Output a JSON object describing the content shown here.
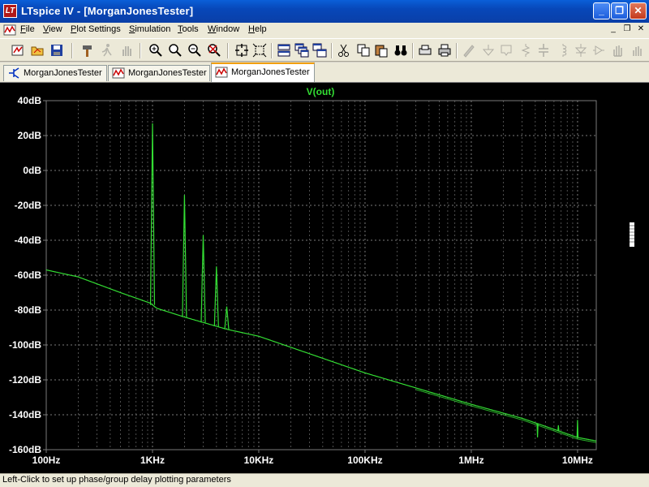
{
  "window": {
    "title": "LTspice IV - [MorganJonesTester]",
    "app_icon_glyph": "LT",
    "minimize_glyph": "_",
    "maximize_glyph": "❐",
    "close_glyph": "✕"
  },
  "menu": {
    "items": [
      "File",
      "View",
      "Plot Settings",
      "Simulation",
      "Tools",
      "Window",
      "Help"
    ],
    "doc_minimize_glyph": "_",
    "doc_restore_glyph": "❐",
    "doc_close_glyph": "✕"
  },
  "tabs": [
    {
      "label": "MorganJonesTester",
      "icon": "schematic-icon",
      "active": false
    },
    {
      "label": "MorganJonesTester",
      "icon": "waveform-icon",
      "active": false
    },
    {
      "label": "MorganJonesTester",
      "icon": "waveform-icon",
      "active": true
    }
  ],
  "colors": {
    "trace": "#33dd33",
    "grid": "#7a7a7a",
    "axis_text": "#ffffff",
    "trace_label": "#33dd33",
    "plot_bg": "#000000"
  },
  "chart_data": {
    "type": "line",
    "title": "V(out)",
    "x_scale": "log",
    "xlim": [
      100,
      15000000
    ],
    "ylim": [
      -160,
      40
    ],
    "x_ticks": [
      {
        "value": 100,
        "label": "100Hz"
      },
      {
        "value": 1000,
        "label": "1KHz"
      },
      {
        "value": 10000,
        "label": "10KHz"
      },
      {
        "value": 100000,
        "label": "100KHz"
      },
      {
        "value": 1000000,
        "label": "1MHz"
      },
      {
        "value": 10000000,
        "label": "10MHz"
      }
    ],
    "y_ticks": [
      {
        "value": 40,
        "label": "40dB"
      },
      {
        "value": 20,
        "label": "20dB"
      },
      {
        "value": 0,
        "label": "0dB"
      },
      {
        "value": -20,
        "label": "-20dB"
      },
      {
        "value": -40,
        "label": "-40dB"
      },
      {
        "value": -60,
        "label": "-60dB"
      },
      {
        "value": -80,
        "label": "-80dB"
      },
      {
        "value": -100,
        "label": "-100dB"
      },
      {
        "value": -120,
        "label": "-120dB"
      },
      {
        "value": -140,
        "label": "-140dB"
      },
      {
        "value": -160,
        "label": "-160dB"
      }
    ],
    "grid": true,
    "series": [
      {
        "name": "V(out)",
        "floor": [
          [
            100,
            -57
          ],
          [
            200,
            -61
          ],
          [
            500,
            -70
          ],
          [
            950,
            -76
          ],
          [
            1100,
            -79
          ],
          [
            2000,
            -84
          ],
          [
            5000,
            -91
          ],
          [
            10000,
            -95
          ],
          [
            100000,
            -116
          ],
          [
            1000000,
            -134
          ],
          [
            3000000,
            -142
          ],
          [
            10000000,
            -153
          ],
          [
            15000000,
            -155
          ]
        ],
        "peaks": [
          {
            "freq": 1000,
            "db": 27
          },
          {
            "freq": 2000,
            "db": -14
          },
          {
            "freq": 3000,
            "db": -37
          },
          {
            "freq": 4000,
            "db": -55
          },
          {
            "freq": 5000,
            "db": -78
          },
          {
            "freq": 4200000,
            "db": -153
          },
          {
            "freq": 6600000,
            "db": -146
          },
          {
            "freq": 10000000,
            "db": -143
          }
        ]
      }
    ]
  },
  "status": {
    "text": "Left-Click to set up phase/group delay plotting parameters"
  }
}
